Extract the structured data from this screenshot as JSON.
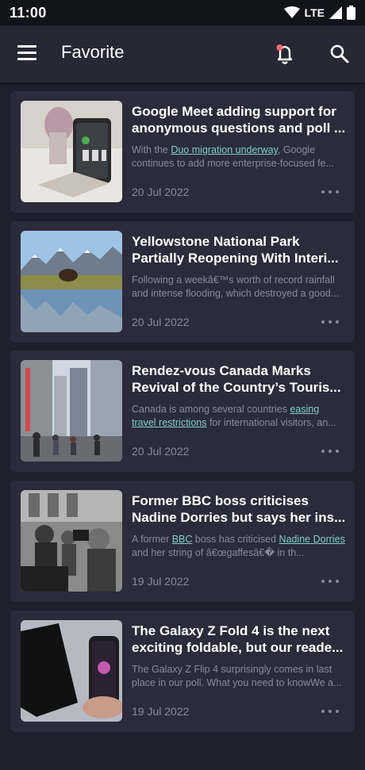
{
  "status_bar": {
    "time": "11:00",
    "network": "LTE",
    "icons": [
      "wifi-icon",
      "signal-icon",
      "battery-icon"
    ]
  },
  "app_bar": {
    "title": "Favorite",
    "icons": [
      "menu-icon",
      "notification-bell-icon",
      "search-icon"
    ]
  },
  "colors": {
    "background": "#1f1f2e",
    "app_bar": "#272736",
    "card": "#2b2b3b",
    "link": "#7fd0c6",
    "notification_dot": "#ff6b6b"
  },
  "articles": [
    {
      "title": "Google Meet adding support for anonymous questions and poll ...",
      "excerpt_before": "With the ",
      "excerpt_link": "Duo migration underway",
      "excerpt_after": ", Google continues to add more enterprise-focused fe...",
      "date": "20 Jul 2022",
      "image": "foldable-phone-google-meet"
    },
    {
      "title": "Yellowstone National Park Partially Reopening With Interi...",
      "excerpt_before": "Following a weekâ€™s worth of record rainfall and intense flooding, which destroyed a good...",
      "excerpt_link": "",
      "excerpt_after": "",
      "date": "20 Jul 2022",
      "image": "bison-mountains-lake"
    },
    {
      "title": "Rendez-vous Canada Marks Revival of the Country’s Touris...",
      "excerpt_before": "Canada is among several countries ",
      "excerpt_link": "easing travel restrictions",
      "excerpt_after": " for international visitors, an...",
      "date": "20 Jul 2022",
      "image": "city-street-crowd"
    },
    {
      "title": "Former BBC boss criticises Nadine Dorries but says her ins...",
      "excerpt_before": "A former ",
      "excerpt_link": "BBC",
      "excerpt_mid": " boss has criticised ",
      "excerpt_link2": "Nadine Dorries",
      "excerpt_after": " and her string of â€œgaffesâ€� in th...",
      "date": "19 Jul 2022",
      "image": "press-crowd-black-white"
    },
    {
      "title": "The Galaxy Z Fold 4 is the next exciting foldable, but our reade...",
      "excerpt_before": "The Galaxy Z Flip 4 surprisingly comes in last place in our poll. What you need to knowWe a...",
      "excerpt_link": "",
      "excerpt_after": "",
      "date": "19 Jul 2022",
      "image": "galaxy-foldable-phones"
    }
  ]
}
